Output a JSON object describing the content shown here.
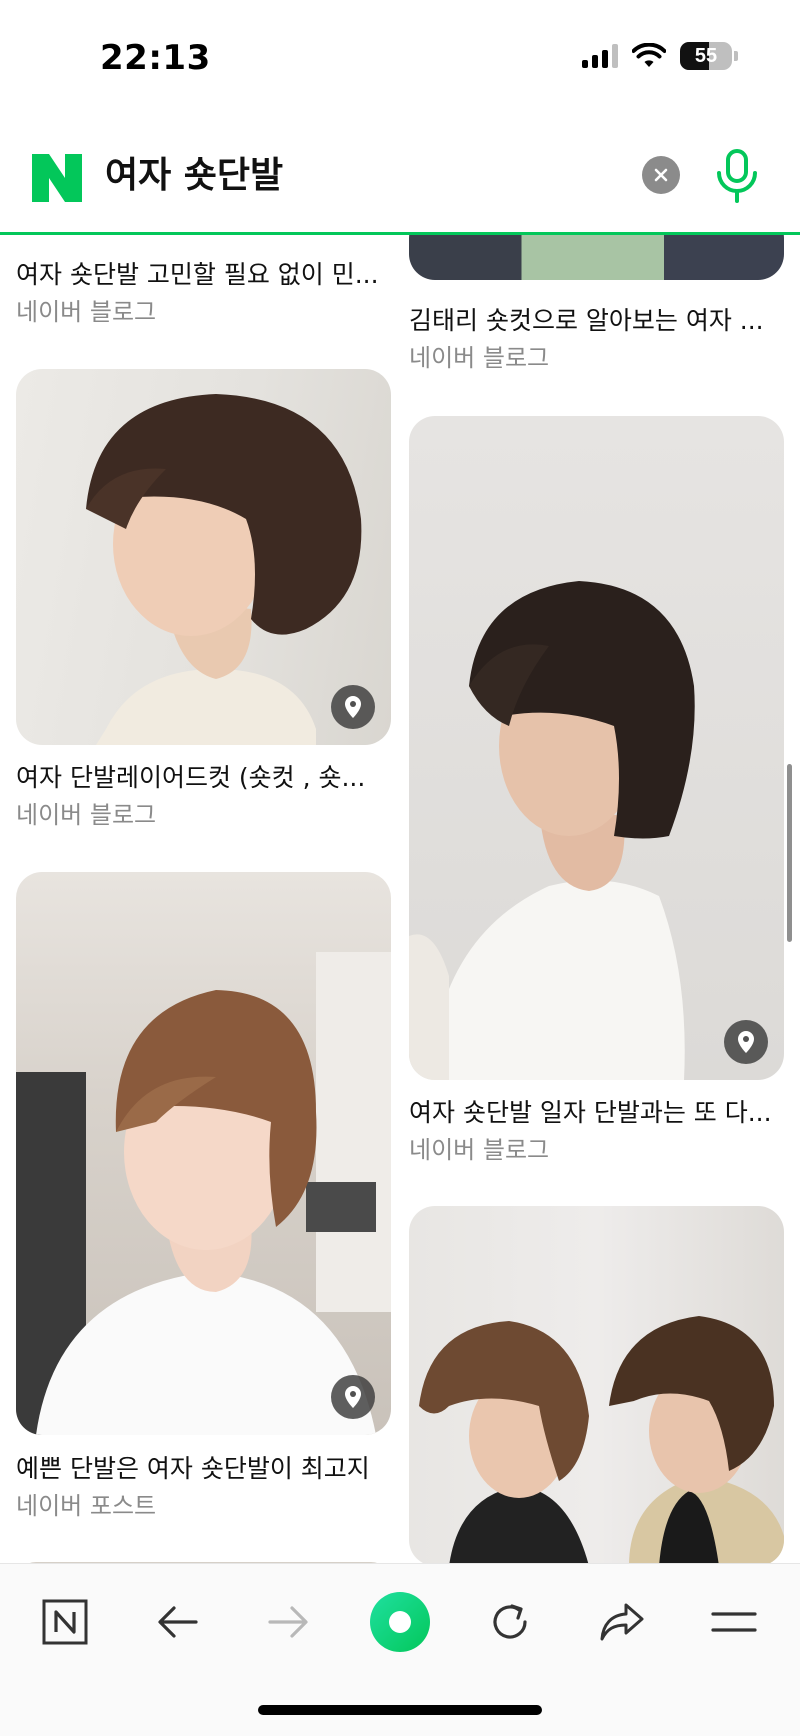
{
  "status_bar": {
    "time": "22:13",
    "battery": "55",
    "battery_level": 0.55
  },
  "search": {
    "query": "여자 숏단발",
    "clear_icon": "close-icon",
    "mic_icon": "microphone-icon",
    "logo_icon": "naver-logo-icon"
  },
  "left_column": [
    {
      "title": "여자 숏단발 고민할 필요 없이 민...",
      "source": "네이버 블로그",
      "has_place_pin": false
    },
    {
      "title": "여자 단발레이어드컷 (숏컷 , 숏...",
      "source": "네이버 블로그",
      "has_place_pin": true
    },
    {
      "title": "예쁜 단발은 여자 숏단발이 최고지",
      "source": "네이버 포스트",
      "has_place_pin": true
    }
  ],
  "right_column": [
    {
      "title": "김태리 숏컷으로 알아보는 여자 ...",
      "source": "네이버 블로그",
      "has_place_pin": false
    },
    {
      "title": "여자 숏단발 일자 단발과는 또 다...",
      "source": "네이버 블로그",
      "has_place_pin": true
    },
    {
      "title": "",
      "source": "",
      "has_place_pin": false
    }
  ],
  "toolbar": {
    "items": [
      "naver-home-icon",
      "back-icon",
      "forward-icon",
      "green-dot-icon",
      "refresh-icon",
      "share-icon",
      "menu-icon"
    ],
    "accent": "#03c75a"
  },
  "colors": {
    "brand_green": "#03c75a",
    "source_gray": "#8a8a8a"
  }
}
